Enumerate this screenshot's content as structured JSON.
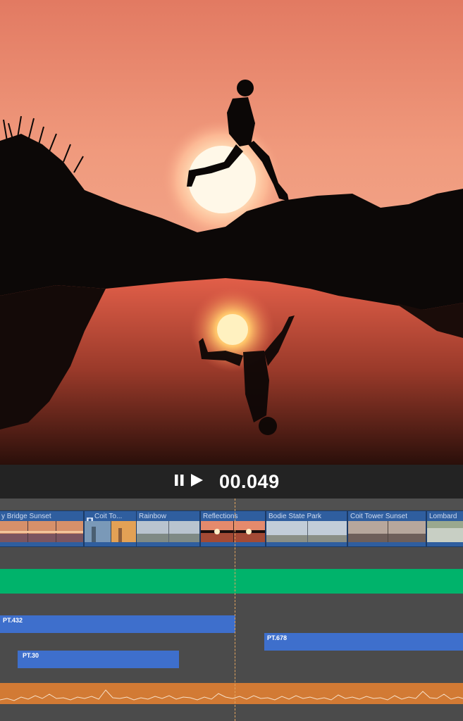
{
  "transport": {
    "timecode": "00.049"
  },
  "clips": [
    {
      "label": "y Bridge Sunset"
    },
    {
      "label": "Coit To..."
    },
    {
      "label": "Rainbow"
    },
    {
      "label": "Reflections"
    },
    {
      "label": "Bodie State Park"
    },
    {
      "label": "Coit Tower Sunset"
    },
    {
      "label": "Lombard"
    }
  ],
  "blue_tracks": [
    {
      "label": "PT.432"
    },
    {
      "label": "PT.678"
    },
    {
      "label": "PT.30"
    }
  ],
  "colors": {
    "track_green": "#00b36b",
    "track_blue": "#3e6fcc",
    "audio_orange": "#d27a34",
    "clip_blue": "#2f5e9f",
    "playhead": "#e3a55f"
  },
  "icons": {
    "pause": "pause-icon",
    "play": "play-icon",
    "camera": "camera-icon"
  }
}
